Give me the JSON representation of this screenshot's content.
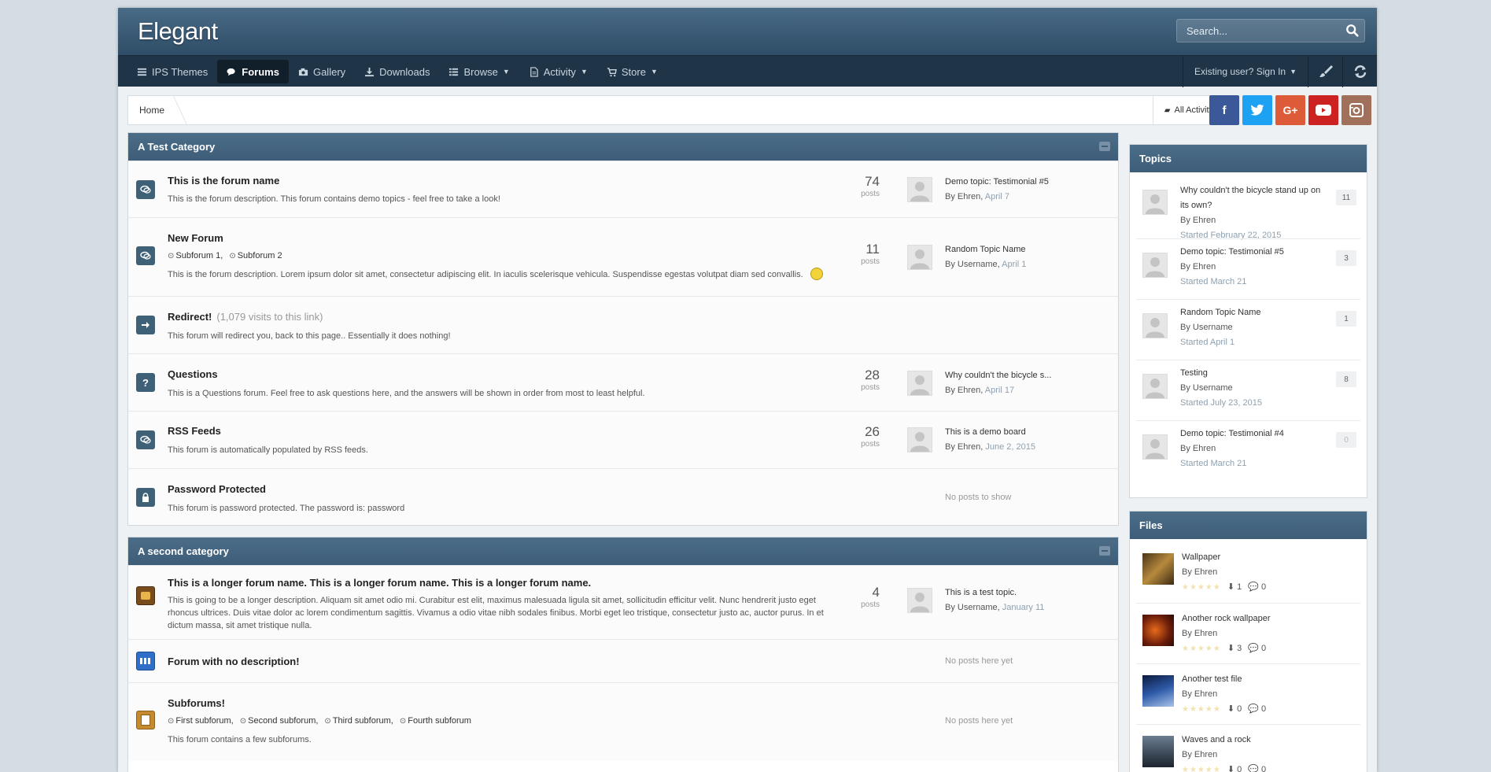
{
  "header": {
    "logo": "Elegant",
    "search_placeholder": "Search..."
  },
  "nav": {
    "items": [
      {
        "label": "IPS Themes",
        "icon": "list-icon"
      },
      {
        "label": "Forums",
        "icon": "comments-icon",
        "active": true
      },
      {
        "label": "Gallery",
        "icon": "camera-icon"
      },
      {
        "label": "Downloads",
        "icon": "download-icon"
      },
      {
        "label": "Browse",
        "icon": "table-icon"
      },
      {
        "label": "Activity",
        "icon": "file-icon"
      },
      {
        "label": "Store",
        "icon": "cart-icon"
      }
    ],
    "signin": "Existing user? Sign In"
  },
  "breadcrumb": {
    "home": "Home",
    "all_activity": "All Activity"
  },
  "social": [
    {
      "name": "facebook",
      "glyph": "f",
      "color": "#3b5998"
    },
    {
      "name": "twitter",
      "glyph": "t",
      "color": "#1da1f2"
    },
    {
      "name": "google-plus",
      "glyph": "G+",
      "color": "#dd5b38"
    },
    {
      "name": "youtube",
      "glyph": "▶",
      "color": "#cc2222"
    },
    {
      "name": "instagram",
      "glyph": "◎",
      "color": "#a0705a"
    }
  ],
  "categories": [
    {
      "title": "A Test Category",
      "forums": [
        {
          "title": "This is the forum name",
          "desc": "This is the forum description. This forum contains demo topics - feel free to take a look!",
          "posts": "74",
          "posts_label": "posts",
          "last_title": "Demo topic: Testimonial #5",
          "last_by": "By Ehren,",
          "last_date": "April 7"
        },
        {
          "title": "New Forum",
          "subforums": [
            "Subforum 1,",
            "Subforum 2"
          ],
          "desc": "This is the forum description. Lorem ipsum dolor sit amet, consectetur adipiscing elit. In iaculis scelerisque vehicula. Suspendisse egestas volutpat diam sed convallis.",
          "posts": "11",
          "posts_label": "posts",
          "last_title": "Random Topic Name",
          "last_by": "By Username,",
          "last_date": "April 1"
        },
        {
          "title": "Redirect!",
          "redirect_count": "(1,079 visits to this link)",
          "desc": "This forum will redirect you, back to this page.. Essentially it does nothing!"
        },
        {
          "title": "Questions",
          "desc": "This is a Questions forum. Feel free to ask questions here, and the answers will be shown in order from most to least helpful.",
          "posts": "28",
          "posts_label": "posts",
          "last_title": "Why couldn't the bicycle s...",
          "last_by": "By Ehren,",
          "last_date": "April 17"
        },
        {
          "title": "RSS Feeds",
          "desc": "This forum is automatically populated by RSS feeds.",
          "posts": "26",
          "posts_label": "posts",
          "last_title": "This is a demo board",
          "last_by": "By Ehren,",
          "last_date": "June 2, 2015"
        },
        {
          "title": "Password Protected",
          "desc": "This forum is password protected. The password is: password",
          "no_posts": "No posts to show"
        }
      ]
    },
    {
      "title": "A second category",
      "forums": [
        {
          "title": "This is a longer forum name. This is a longer forum name. This is a longer forum name.",
          "desc": "This is going to be a longer description. Aliquam sit amet odio mi. Curabitur est elit, maximus malesuada ligula sit amet, sollicitudin efficitur velit. Nunc hendrerit justo eget rhoncus ultrices. Duis vitae dolor ac lorem condimentum sagittis. Vivamus a odio vitae nibh sodales finibus. Morbi eget leo tristique, consectetur justo ac, auctor purus. In et dictum massa, sit amet tristique nulla.",
          "posts": "4",
          "posts_label": "posts",
          "last_title": "This is a test topic.",
          "last_by": "By Username,",
          "last_date": "January 11"
        },
        {
          "title": "Forum with no description!",
          "no_posts": "No posts here yet"
        },
        {
          "title": "Subforums!",
          "subforums": [
            "First subforum,",
            "Second subforum,",
            "Third subforum,",
            "Fourth subforum"
          ],
          "desc": "This forum contains a few subforums.",
          "no_posts": "No posts here yet"
        }
      ]
    }
  ],
  "topics": {
    "title": "Topics",
    "items": [
      {
        "title": "Why couldn't the bicycle stand up on its own?",
        "by": "By Ehren",
        "started": "Started February 22, 2015",
        "count": "11"
      },
      {
        "title": "Demo topic: Testimonial #5",
        "by": "By Ehren",
        "started": "Started March 21",
        "count": "3"
      },
      {
        "title": "Random Topic Name",
        "by": "By Username",
        "started": "Started April 1",
        "count": "1"
      },
      {
        "title": "Testing",
        "by": "By Username",
        "started": "Started July 23, 2015",
        "count": "8"
      },
      {
        "title": "Demo topic: Testimonial #4",
        "by": "By Ehren",
        "started": "Started March 21",
        "count": "0"
      }
    ]
  },
  "files": {
    "title": "Files",
    "items": [
      {
        "title": "Wallpaper",
        "by": "By Ehren",
        "downloads": "1",
        "comments": "0"
      },
      {
        "title": "Another rock wallpaper",
        "by": "By Ehren",
        "downloads": "3",
        "comments": "0"
      },
      {
        "title": "Another test file",
        "by": "By Ehren",
        "downloads": "0",
        "comments": "0"
      },
      {
        "title": "Waves and a rock",
        "by": "By Ehren",
        "downloads": "0",
        "comments": "0"
      }
    ]
  }
}
